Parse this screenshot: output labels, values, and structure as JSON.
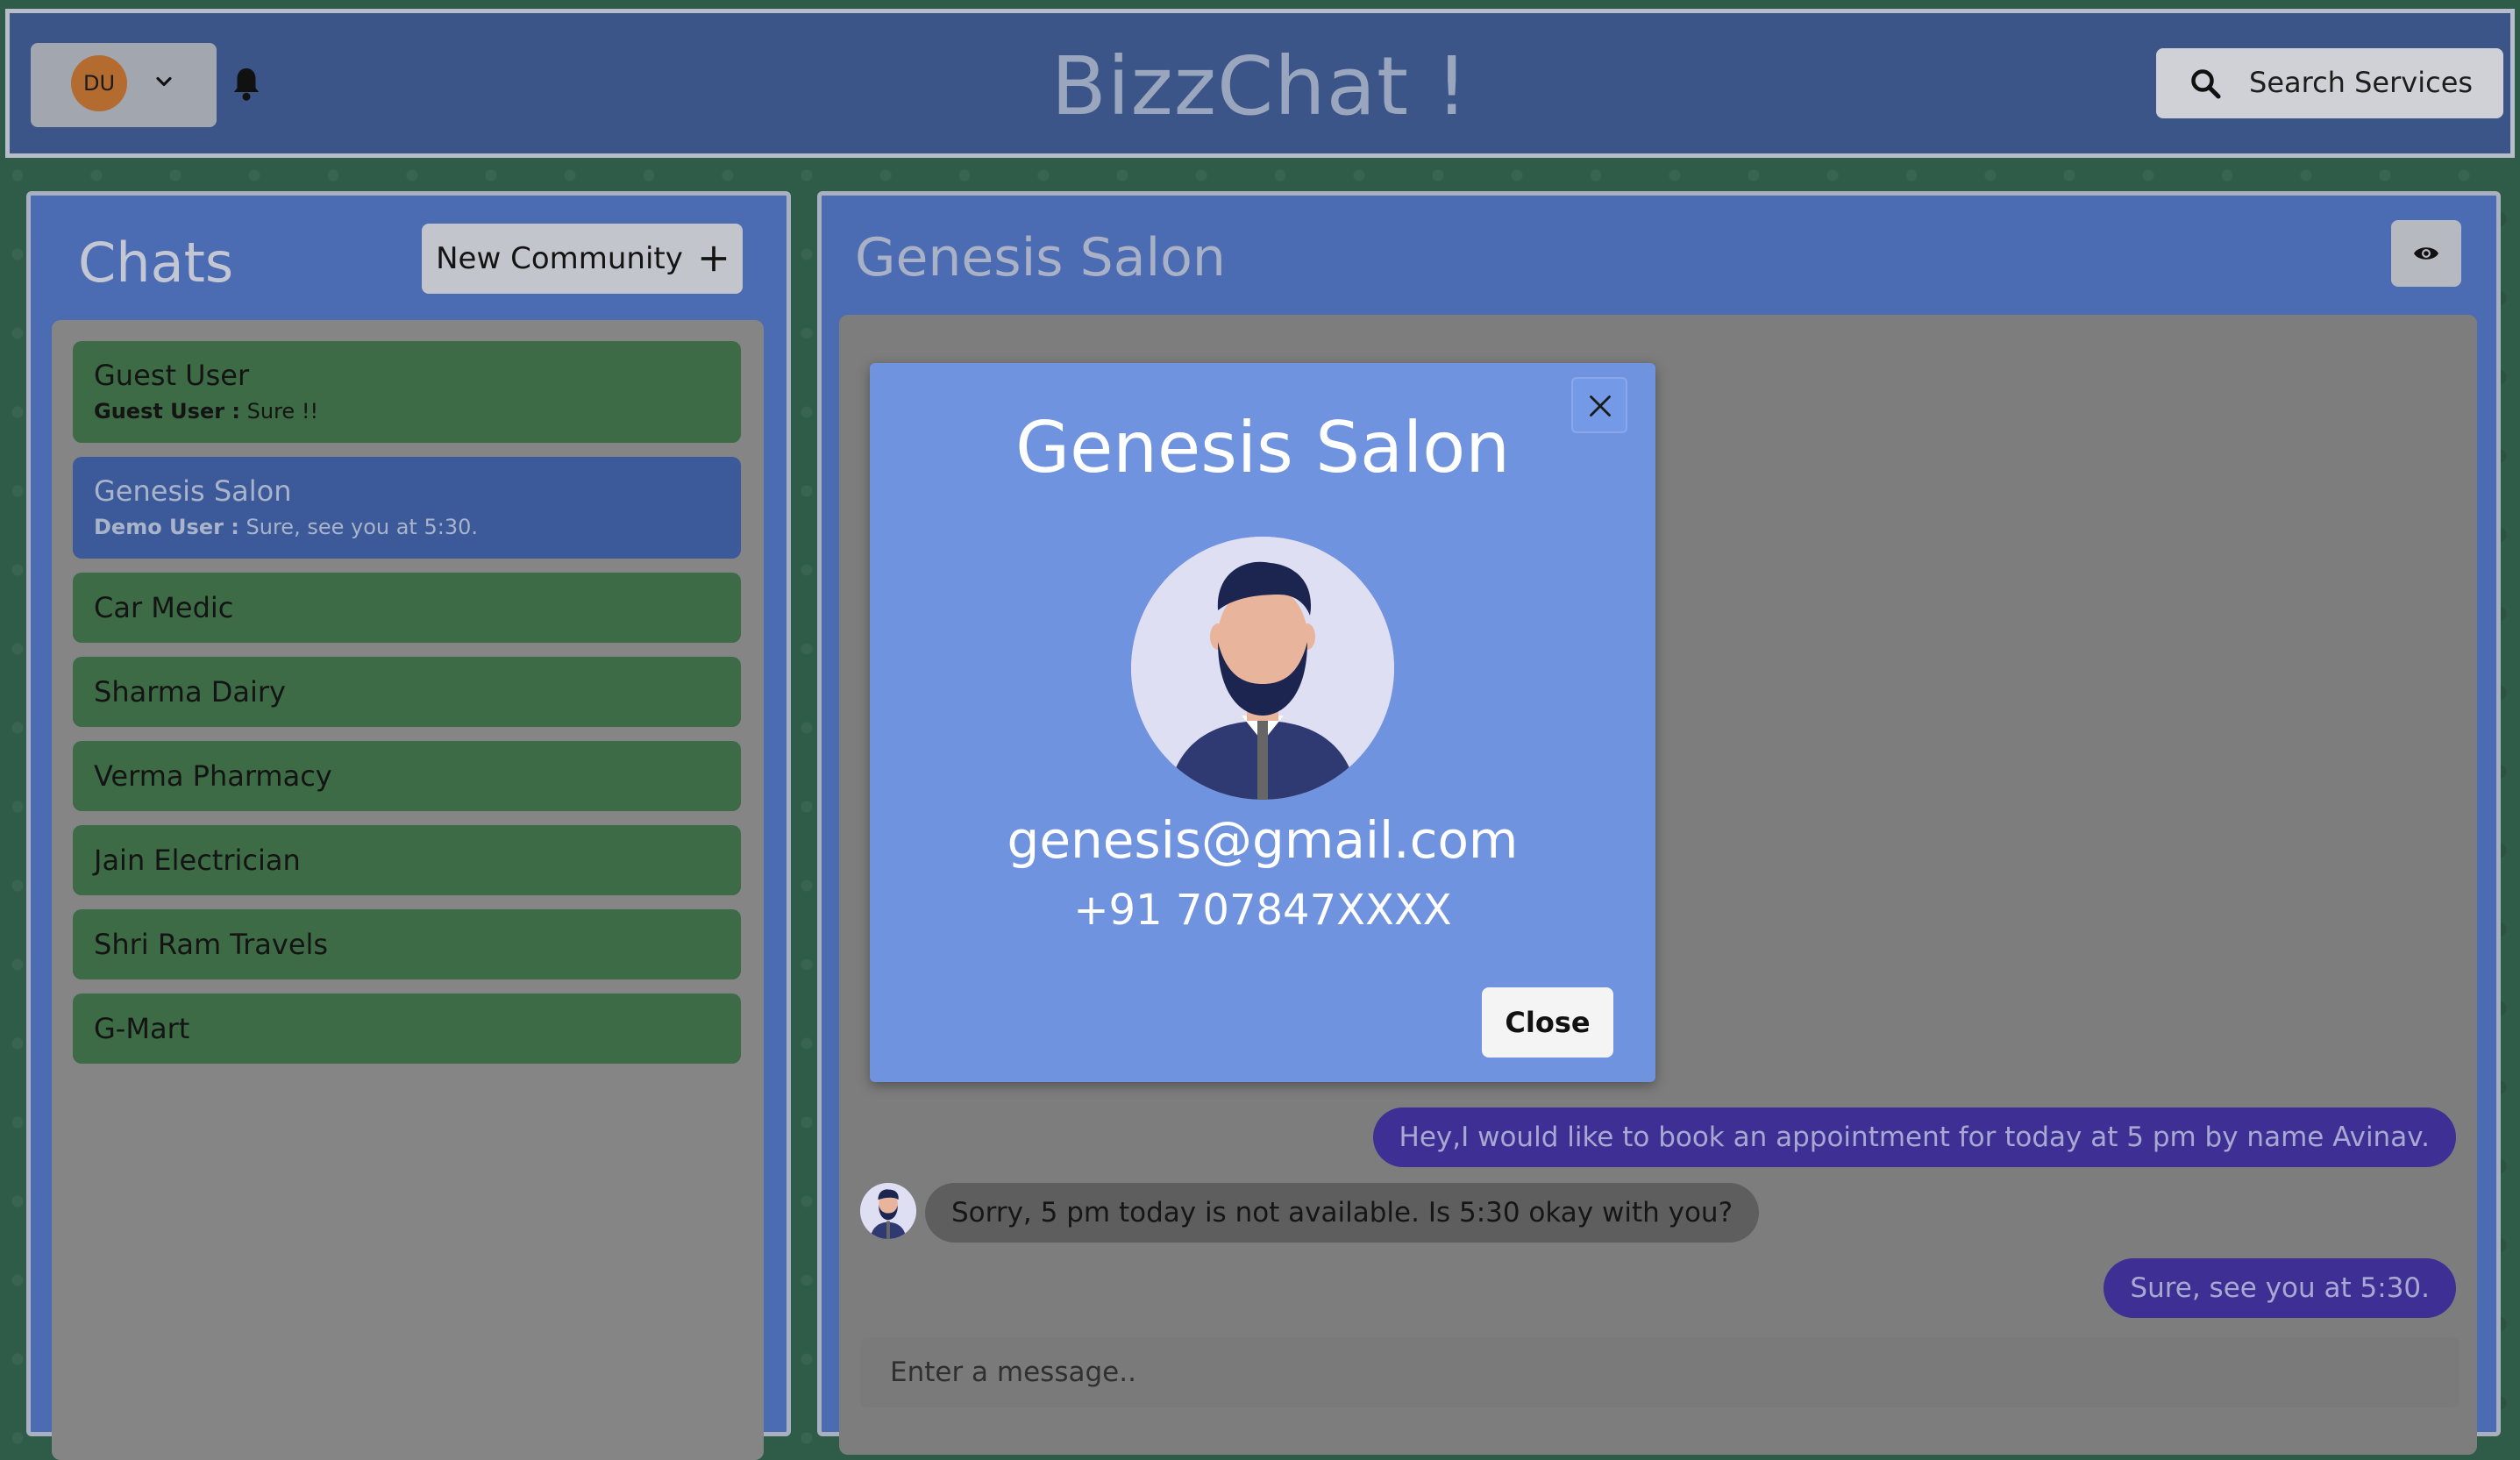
{
  "header": {
    "brand": "BizzChat !",
    "user_initials": "DU",
    "search_label": "Search Services"
  },
  "chats_panel": {
    "title": "Chats",
    "new_community_label": "New Community",
    "items": [
      {
        "name": "Guest User",
        "preview_sender": "Guest User :",
        "preview_text": " Sure !!"
      },
      {
        "name": "Genesis Salon",
        "preview_sender": "Demo User :",
        "preview_text": " Sure, see you at 5:30."
      },
      {
        "name": "Car Medic"
      },
      {
        "name": "Sharma Dairy"
      },
      {
        "name": "Verma Pharmacy"
      },
      {
        "name": "Jain Electrician"
      },
      {
        "name": "Shri Ram Travels"
      },
      {
        "name": "G-Mart"
      }
    ]
  },
  "conversation": {
    "title": "Genesis Salon",
    "messages": [
      {
        "direction": "out",
        "text": "Hey,I would like to book an appointment for today at 5 pm by name Avinav."
      },
      {
        "direction": "in",
        "text": "Sorry, 5 pm today is not available. Is 5:30 okay with you?"
      },
      {
        "direction": "out",
        "text": "Sure, see you at 5:30."
      }
    ],
    "input_placeholder": "Enter a message.."
  },
  "modal": {
    "title": "Genesis Salon",
    "email": "genesis@gmail.com",
    "phone": "+91 707847XXXX",
    "close_label": "Close"
  }
}
